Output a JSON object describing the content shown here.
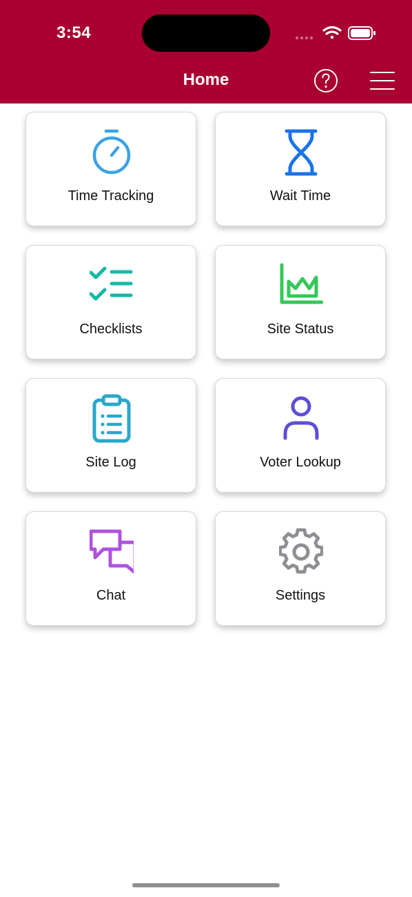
{
  "status_bar": {
    "time": "3:54"
  },
  "nav": {
    "title": "Home",
    "help_icon": "question-circle-icon",
    "menu_icon": "hamburger-menu-icon"
  },
  "theme": {
    "header_bg": "#a90031",
    "header_text": "#ffffff"
  },
  "tiles": [
    {
      "label": "Time Tracking",
      "icon": "stopwatch-icon",
      "color": "#3aa3e3"
    },
    {
      "label": "Wait Time",
      "icon": "hourglass-icon",
      "color": "#1a73e8"
    },
    {
      "label": "Checklists",
      "icon": "checklist-icon",
      "color": "#14b8a6"
    },
    {
      "label": "Site Status",
      "icon": "area-chart-icon",
      "color": "#34c759"
    },
    {
      "label": "Site Log",
      "icon": "clipboard-icon",
      "color": "#2aa7c9"
    },
    {
      "label": "Voter Lookup",
      "icon": "person-icon",
      "color": "#5b4fd6"
    },
    {
      "label": "Chat",
      "icon": "chat-bubbles-icon",
      "color": "#af52de"
    },
    {
      "label": "Settings",
      "icon": "gear-icon",
      "color": "#8e8e93"
    }
  ]
}
